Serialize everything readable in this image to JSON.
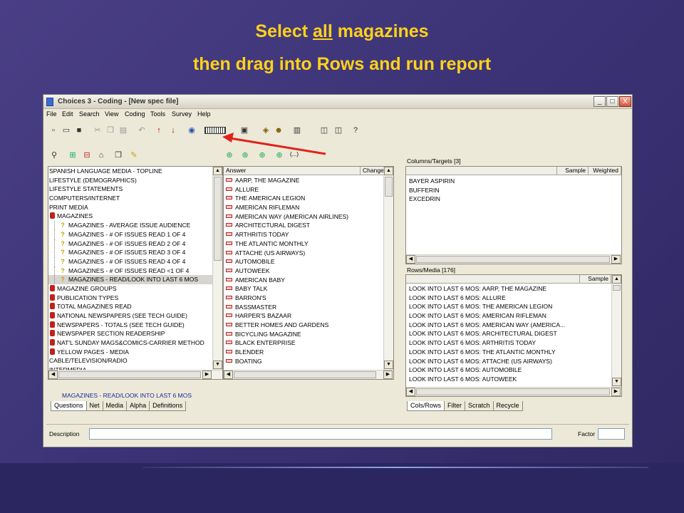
{
  "slide": {
    "title_pre": "Select ",
    "title_underlined": "all",
    "title_post": " magazines",
    "subtitle": "then drag into Rows and run report",
    "title_color": "#ffd21a"
  },
  "window": {
    "title": "Choices 3 - Coding - [New spec file]",
    "minimize": "_",
    "maximize": "□",
    "close": "X",
    "menu": [
      "File",
      "Edit",
      "Search",
      "View",
      "Coding",
      "Tools",
      "Survey",
      "Help"
    ]
  },
  "questions_tree": {
    "items": [
      {
        "label": "SPANISH LANGUAGE MEDIA - TOPLINE",
        "level": 0
      },
      {
        "label": "LIFESTYLE (DEMOGRAPHICS)",
        "level": 0
      },
      {
        "label": "LIFESTYLE STATEMENTS",
        "level": 0
      },
      {
        "label": "COMPUTERS/INTERNET",
        "level": 0
      },
      {
        "label": "PRINT MEDIA",
        "level": 0
      },
      {
        "label": "MAGAZINES",
        "level": 1
      },
      {
        "label": "MAGAZINES - AVERAGE ISSUE AUDIENCE",
        "level": 2
      },
      {
        "label": "MAGAZINES - # OF ISSUES READ 1 OF 4",
        "level": 2
      },
      {
        "label": "MAGAZINES - # OF ISSUES READ 2 OF 4",
        "level": 2
      },
      {
        "label": "MAGAZINES - # OF ISSUES READ 3 OF 4",
        "level": 2
      },
      {
        "label": "MAGAZINES - # OF ISSUES READ 4 OF 4",
        "level": 2
      },
      {
        "label": "MAGAZINES - # OF ISSUES READ <1 OF 4",
        "level": 2
      },
      {
        "label": "MAGAZINES - READ/LOOK INTO LAST 6 MOS",
        "level": 2,
        "selected": true
      },
      {
        "label": "MAGAZINE GROUPS",
        "level": 1
      },
      {
        "label": "PUBLICATION TYPES",
        "level": 1
      },
      {
        "label": "TOTAL MAGAZINES READ",
        "level": 1
      },
      {
        "label": "NATIONAL NEWSPAPERS (SEE TECH GUIDE)",
        "level": 1
      },
      {
        "label": "NEWSPAPERS - TOTALS (SEE TECH GUIDE)",
        "level": 1
      },
      {
        "label": "NEWSPAPER SECTION READERSHIP",
        "level": 1
      },
      {
        "label": "NAT'L SUNDAY MAGS&COMICS-CARRIER METHOD",
        "level": 1
      },
      {
        "label": "YELLOW PAGES - MEDIA",
        "level": 1
      },
      {
        "label": "CABLE/TELEVISION/RADIO",
        "level": 0
      },
      {
        "label": "INTERMEDIA",
        "level": 0
      }
    ],
    "status": "MAGAZINES - READ/LOOK INTO LAST 6 MOS",
    "tabs": [
      "Questions",
      "Net",
      "Media",
      "Alpha",
      "Definitions"
    ]
  },
  "answers": {
    "toolbar_label": "(...)",
    "col_answer": "Answer",
    "col_change": "Change",
    "items": [
      "AARP, THE MAGAZINE",
      "ALLURE",
      "THE AMERICAN LEGION",
      "AMERICAN RIFLEMAN",
      "AMERICAN WAY (AMERICAN AIRLINES)",
      "ARCHITECTURAL DIGEST",
      "ARTHRITIS TODAY",
      "THE ATLANTIC MONTHLY",
      "ATTACHE (US AIRWAYS)",
      "AUTOMOBILE",
      "AUTOWEEK",
      "AMERICAN BABY",
      "BABY TALK",
      "BARRON'S",
      "BASSMASTER",
      "HARPER'S BAZAAR",
      "BETTER HOMES AND GARDENS",
      "BICYCLING MAGAZINE",
      "BLACK ENTERPRISE",
      "BLENDER",
      "BOATING"
    ]
  },
  "columns": {
    "header": "Columns/Targets [3]",
    "col_sample": "Sample",
    "col_weighted": "Weighted",
    "items": [
      "BAYER ASPIRIN",
      "BUFFERIN",
      "EXCEDRIN"
    ]
  },
  "rows": {
    "header": "Rows/Media [176]",
    "col_sample": "Sample",
    "items": [
      "LOOK INTO LAST 6 MOS: AARP, THE MAGAZINE",
      "LOOK INTO LAST 6 MOS: ALLURE",
      "LOOK INTO LAST 6 MOS: THE AMERICAN LEGION",
      "LOOK INTO LAST 6 MOS: AMERICAN RIFLEMAN",
      "LOOK INTO LAST 6 MOS: AMERICAN WAY (AMERICA...",
      "LOOK INTO LAST 6 MOS: ARCHITECTURAL DIGEST",
      "LOOK INTO LAST 6 MOS: ARTHRITIS TODAY",
      "LOOK INTO LAST 6 MOS: THE ATLANTIC MONTHLY",
      "LOOK INTO LAST 6 MOS: ATTACHE (US AIRWAYS)",
      "LOOK INTO LAST 6 MOS: AUTOMOBILE",
      "LOOK INTO LAST 6 MOS: AUTOWEEK"
    ],
    "tabs": [
      "Cols/Rows",
      "Filter",
      "Scratch",
      "Recycle"
    ]
  },
  "bottom": {
    "description_label": "Description",
    "description_value": "",
    "factor_label": "Factor",
    "factor_value": ""
  },
  "annotation": {
    "arrow_color": "#e0241b"
  }
}
